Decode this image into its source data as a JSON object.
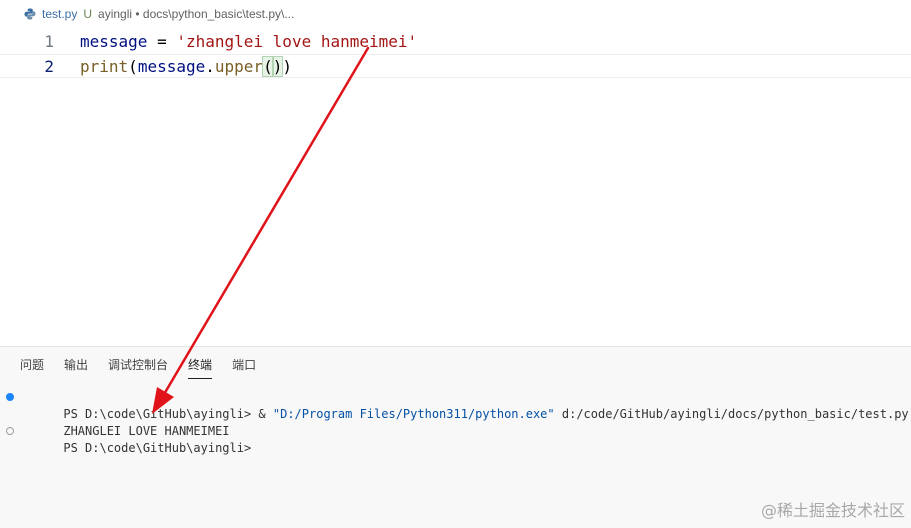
{
  "breadcrumb": {
    "file": "test.py",
    "status": "U",
    "path": "ayingli • docs\\python_basic\\test.py\\..."
  },
  "editor": {
    "lines": [
      {
        "number": "1",
        "tokens": {
          "var": "message",
          "op": " = ",
          "str": "'zhanglei love hanmeimei'"
        }
      },
      {
        "number": "2",
        "tokens": {
          "fn": "print",
          "open": "(",
          "var": "message",
          "dot": ".",
          "method": "upper",
          "inner_open": "(",
          "inner_close": ")",
          "close": ")"
        }
      }
    ]
  },
  "panel": {
    "tabs": [
      "问题",
      "输出",
      "调试控制台",
      "终端",
      "端口"
    ],
    "active_tab": "终端"
  },
  "terminal": {
    "line1_prompt": "PS D:\\code\\GitHub\\ayingli> & ",
    "line1_exe": "\"D:/Program Files/Python311/python.exe\"",
    "line1_arg": " d:/code/GitHub/ayingli/docs/python_basic/test.py",
    "line2": "ZHANGLEI LOVE HANMEIMEI",
    "line3": "PS D:\\code\\GitHub\\ayingli>"
  },
  "watermark": "@稀土掘金技术社区",
  "colors": {
    "annotation_arrow": "#e0131a",
    "terminal_dot": "#1a85ff"
  },
  "icons": {
    "file": "python-file-icon",
    "annotation": "red-arrow"
  }
}
